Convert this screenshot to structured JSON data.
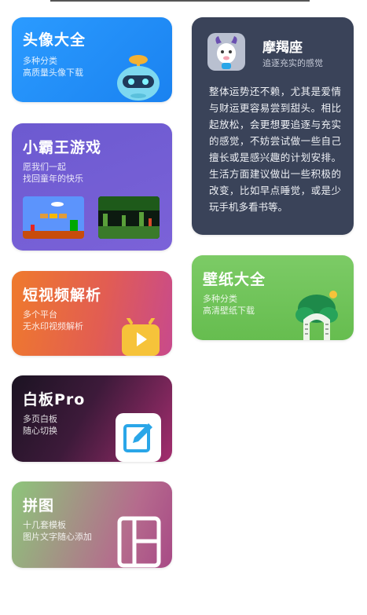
{
  "cards": {
    "avatar": {
      "title": "头像大全",
      "line1": "多种分类",
      "line2": "高质量头像下载"
    },
    "game": {
      "title": "小霸王游戏",
      "line1": "愿我们一起",
      "line2": "找回童年的快乐"
    },
    "video": {
      "title": "短视频解析",
      "line1": "多个平台",
      "line2": "无水印视频解析"
    },
    "whiteboard": {
      "title": "白板Pro",
      "line1": "多页白板",
      "line2": "随心切换"
    },
    "collage": {
      "title": "拼图",
      "line1": "十几套模板",
      "line2": "图片文字随心添加"
    },
    "wallpaper": {
      "title": "壁纸大全",
      "line1": "多种分类",
      "line2": "高清壁纸下载"
    }
  },
  "horoscope": {
    "sign": "摩羯座",
    "tagline": "追逐充实的感觉",
    "body": "整体运势还不赖，尤其是爱情与财运更容易尝到甜头。相比起放松，会更想要追逐与充实的感觉，不妨尝试做一些自己擅长或是感兴趣的计划安排。生活方面建议做出一些积极的改变，比如早点睡觉，或是少玩手机多看书等。"
  },
  "icons": {
    "avatar": "robot-icon",
    "game_left": "mario-game-icon",
    "game_right": "contra-game-icon",
    "video": "play-icon",
    "whiteboard": "pen-edit-icon",
    "collage": "layout-grid-icon",
    "wallpaper": "tree-gate-icon",
    "horoscope": "capricorn-goat-icon"
  }
}
